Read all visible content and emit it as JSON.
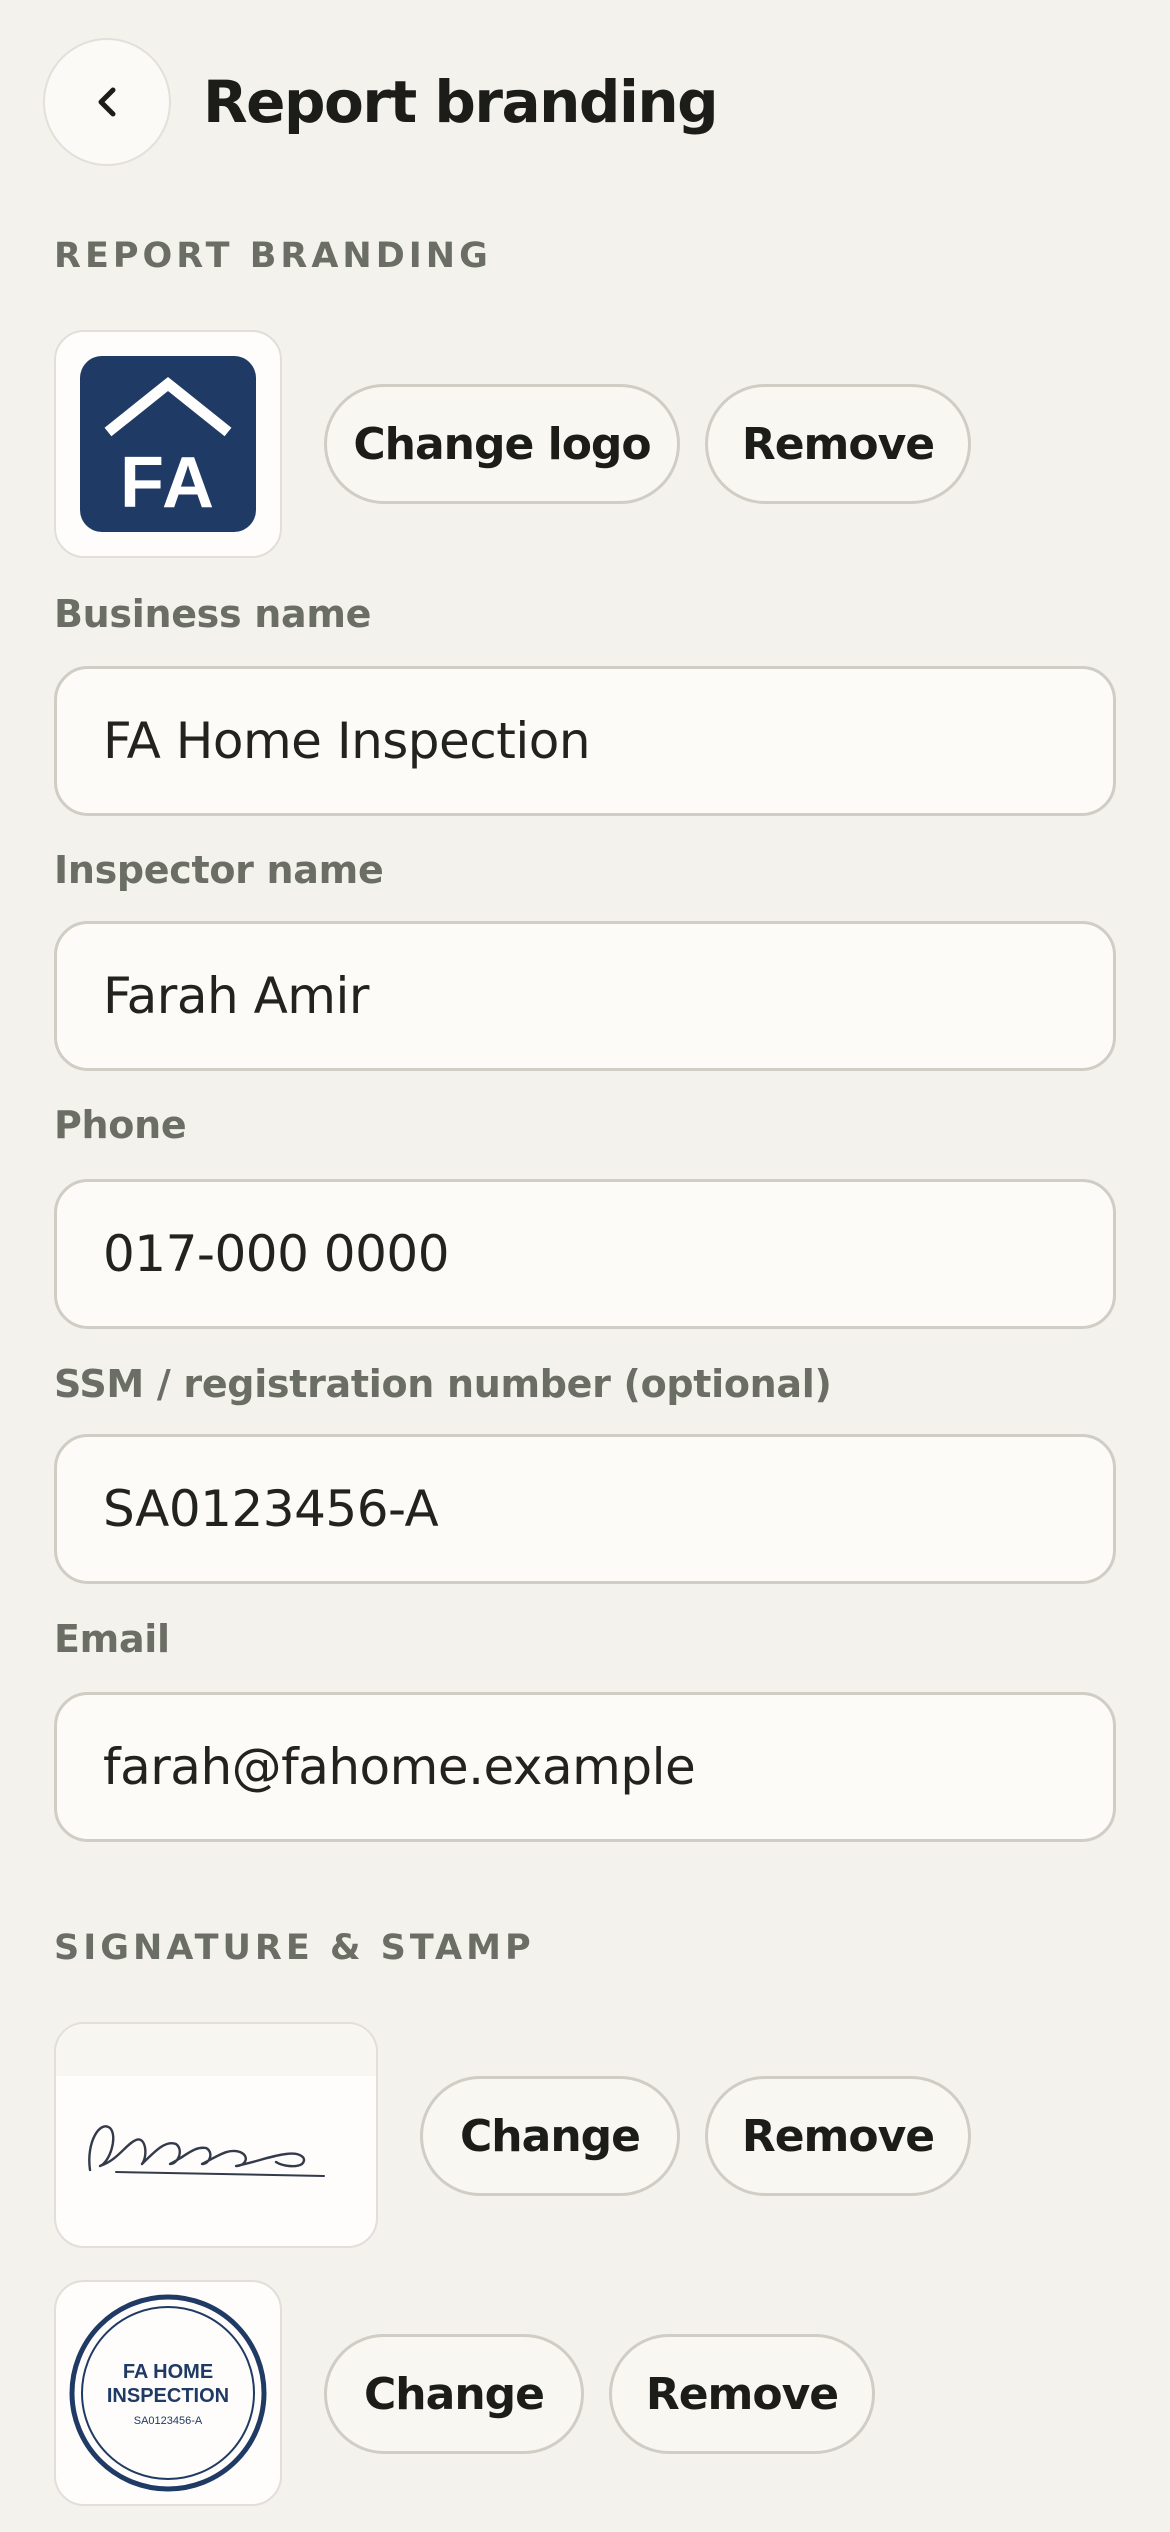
{
  "header": {
    "title": "Report branding"
  },
  "branding": {
    "section_label": "REPORT BRANDING",
    "logo_text": "FA",
    "change_logo_label": "Change logo",
    "remove_label": "Remove"
  },
  "fields": [
    {
      "label": "Business name",
      "value": "FA Home Inspection"
    },
    {
      "label": "Inspector name",
      "value": "Farah Amir"
    },
    {
      "label": "Phone",
      "value": "017-000 0000"
    },
    {
      "label": "SSM / registration number (optional)",
      "value": "SA0123456-A"
    },
    {
      "label": "Email",
      "value": "farah@fahome.example"
    }
  ],
  "signature_stamp": {
    "section_label": "SIGNATURE & STAMP",
    "signature_change_label": "Change",
    "signature_remove_label": "Remove",
    "stamp_line1": "FA HOME",
    "stamp_line2": "INSPECTION",
    "stamp_line3": "SA0123456-A",
    "stamp_change_label": "Change",
    "stamp_remove_label": "Remove"
  },
  "colors": {
    "background": "#f3f2ec",
    "logo_navy": "#1f3a64",
    "label_gray": "#6b6e64"
  },
  "icons": {
    "back": "chevron-left-icon"
  }
}
